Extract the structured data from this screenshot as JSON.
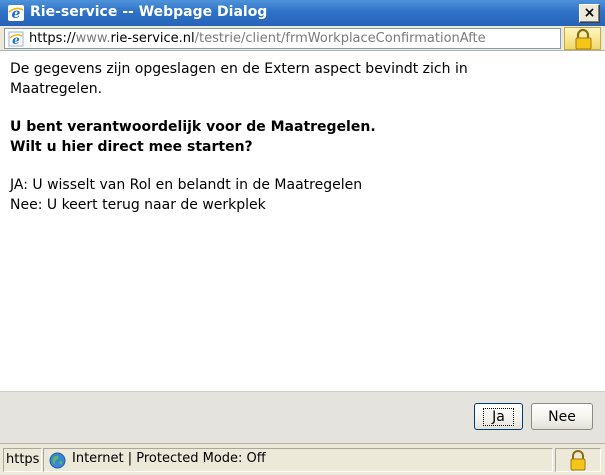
{
  "window": {
    "title": "Rie-service -- Webpage Dialog",
    "close_label": "×"
  },
  "address": {
    "scheme": "https://",
    "host_pre": "www.",
    "host_bold": "rie-service.nl",
    "path": "/testrie/client/frmWorkplaceConfirmationAfte"
  },
  "content": {
    "line1": "De gegevens zijn opgeslagen en de Extern aspect bevindt zich in",
    "line2": "Maatregelen.",
    "bold_line1": "U bent verantwoordelijk voor de Maatregelen.",
    "bold_line2": "Wilt u hier direct mee starten?",
    "info_line1": "JA: U wisselt van Rol en belandt in de Maatregelen",
    "info_line2": "Nee: U keert terug naar de werkplek"
  },
  "buttons": {
    "yes_label": "Ja",
    "no_label": "Nee"
  },
  "statusbar": {
    "url_fragment": "https://",
    "zone_text": "Internet | Protected Mode: Off"
  },
  "icons": {
    "title": "ie-icon",
    "address": "page-icon",
    "lock": "lock-icon",
    "zone": "globe-icon"
  }
}
